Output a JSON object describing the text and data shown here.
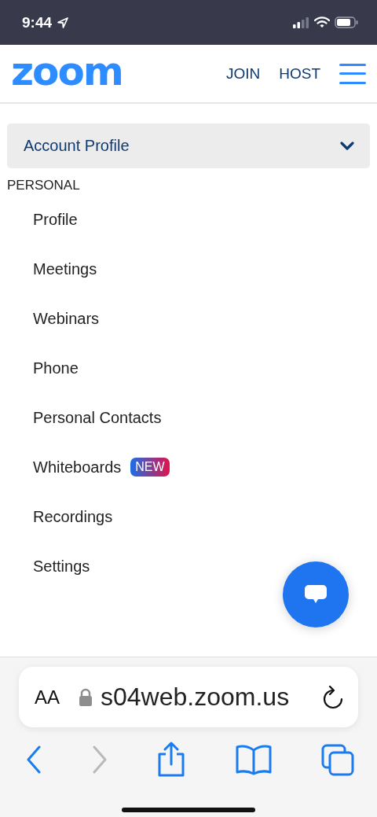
{
  "status_bar": {
    "time": "9:44"
  },
  "header": {
    "logo": "zoom",
    "links": [
      "JOIN",
      "HOST"
    ]
  },
  "account_dropdown": {
    "label": "Account Profile",
    "expanded": false
  },
  "section": {
    "heading": "PERSONAL",
    "items": [
      {
        "label": "Profile"
      },
      {
        "label": "Meetings"
      },
      {
        "label": "Webinars"
      },
      {
        "label": "Phone"
      },
      {
        "label": "Personal Contacts"
      },
      {
        "label": "Whiteboards",
        "badge": "NEW"
      },
      {
        "label": "Recordings"
      },
      {
        "label": "Settings"
      }
    ]
  },
  "browser": {
    "text_size": "AA",
    "url": "s04web.zoom.us",
    "back_disabled": false,
    "forward_disabled": true
  }
}
